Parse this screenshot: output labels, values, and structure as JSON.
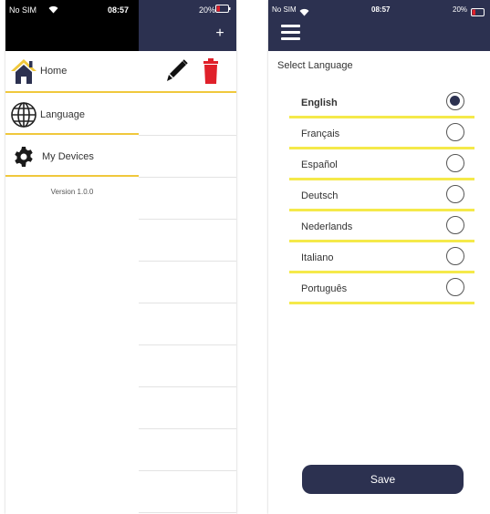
{
  "left_screen": {
    "status": {
      "carrier": "No SIM",
      "time": "08:57",
      "battery": "20%"
    },
    "add_label": "+",
    "menu": [
      {
        "label": "Home",
        "icon": "home-icon"
      },
      {
        "label": "Language",
        "icon": "globe-icon"
      },
      {
        "label": "My Devices",
        "icon": "gear-icon"
      }
    ],
    "version": "Version 1.0.0",
    "actions": {
      "edit_icon": "pencil-icon",
      "delete_icon": "trash-icon",
      "delete_color": "#e0202a"
    }
  },
  "right_screen": {
    "status": {
      "carrier": "No SIM",
      "time": "08:57",
      "battery": "20%"
    },
    "title": "Select Language",
    "languages": [
      {
        "label": "English",
        "selected": true
      },
      {
        "label": "Français",
        "selected": false
      },
      {
        "label": "Español",
        "selected": false
      },
      {
        "label": "Deutsch",
        "selected": false
      },
      {
        "label": "Nederlands",
        "selected": false
      },
      {
        "label": "Italiano",
        "selected": false
      },
      {
        "label": "Português",
        "selected": false
      }
    ],
    "save_label": "Save"
  },
  "colors": {
    "navy": "#2c3150",
    "accent_yellow": "#f0c83c",
    "underline_yellow": "#f5e94a",
    "battery_red": "#e0202a"
  }
}
